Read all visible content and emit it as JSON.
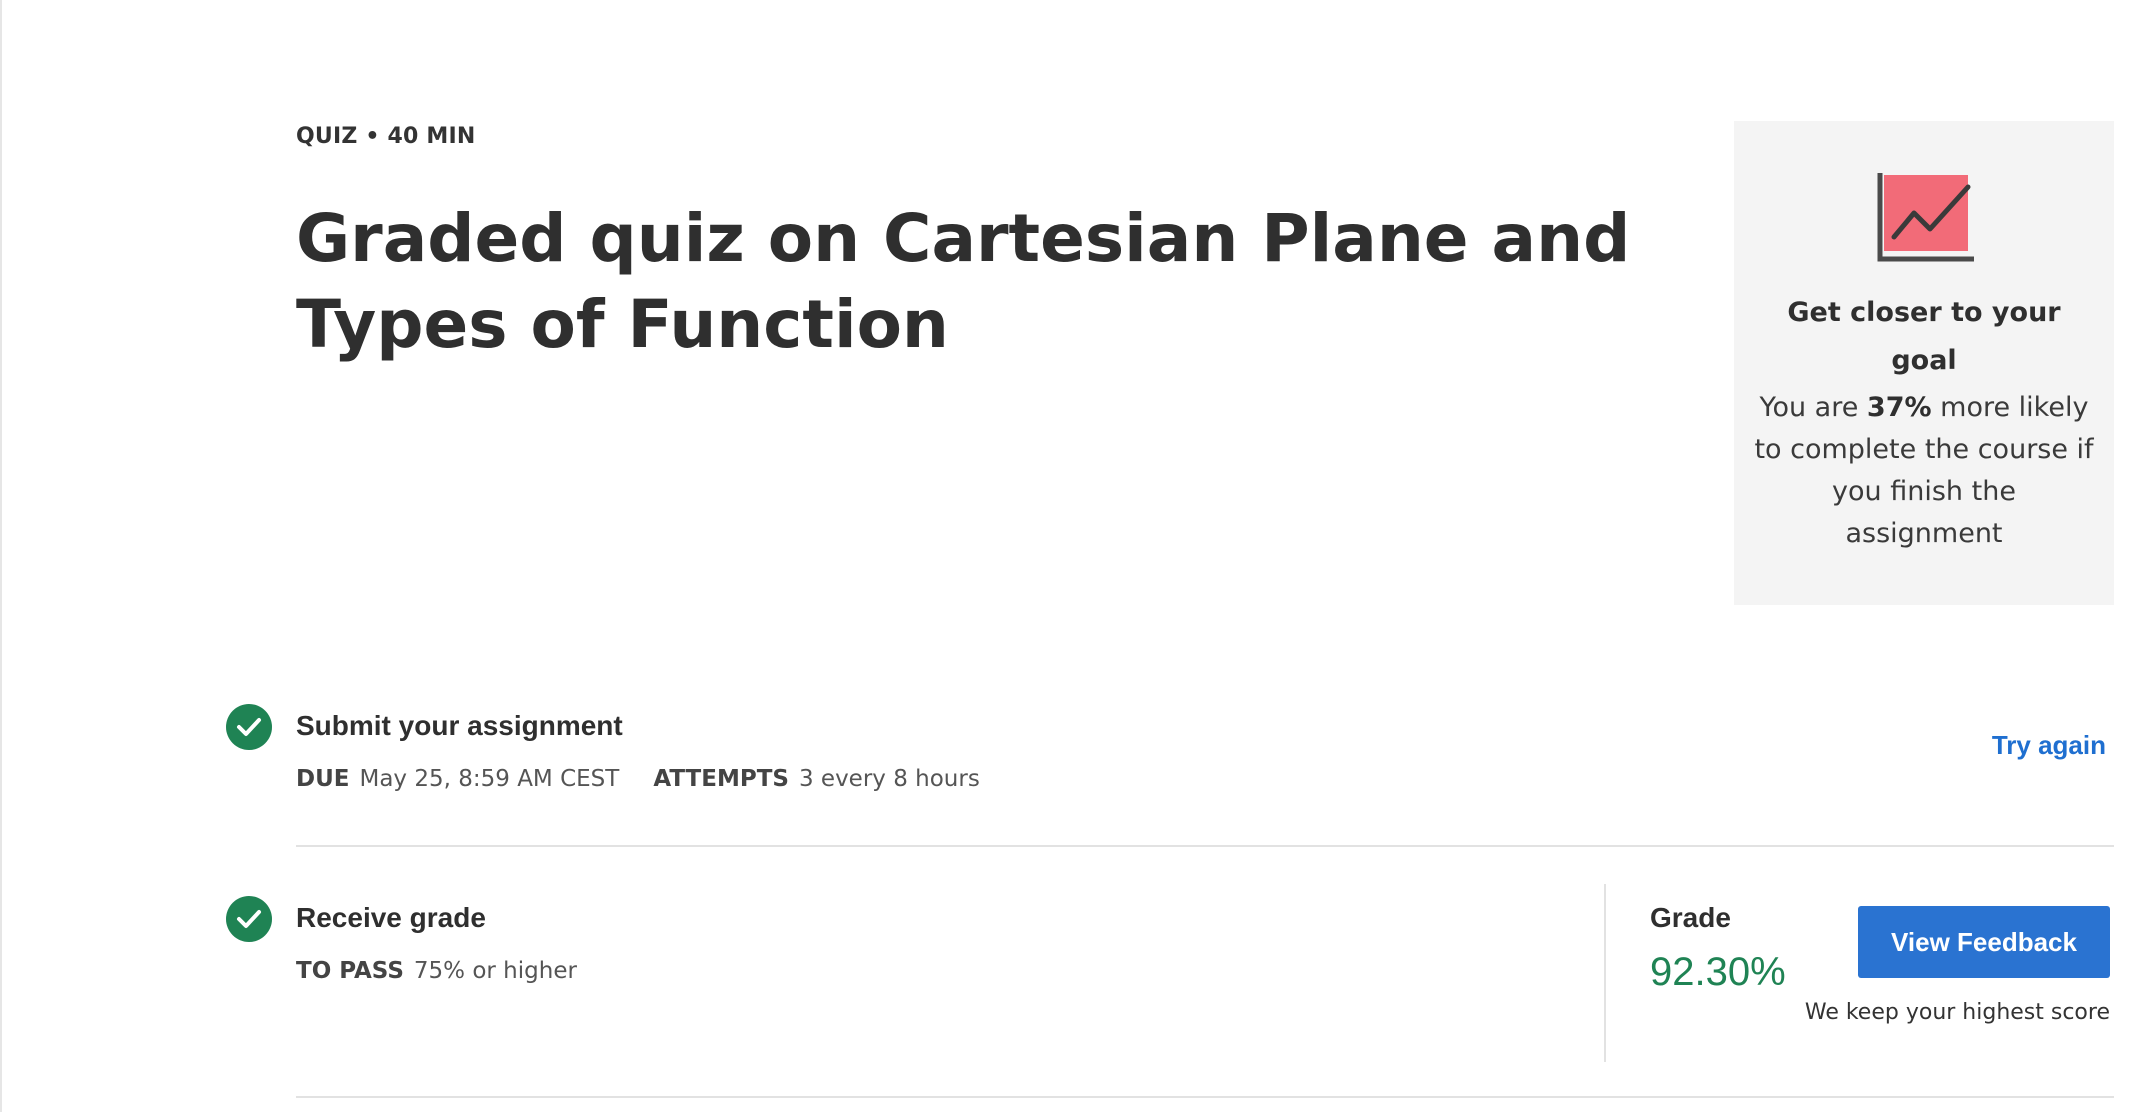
{
  "header": {
    "meta": "QUIZ • 40 MIN",
    "title": "Graded quiz on Cartesian Plane and Types of Function"
  },
  "goal_card": {
    "icon": "trend-chart-icon",
    "heading": "Get closer to your goal",
    "text_prefix": "You are ",
    "percent": "37%",
    "text_suffix": " more likely to complete the course if you finish the assignment"
  },
  "submit": {
    "title": "Submit your assignment",
    "due_label": "DUE",
    "due_value": "May 25, 8:59 AM CEST",
    "attempts_label": "ATTEMPTS",
    "attempts_value": "3 every 8 hours",
    "try_again": "Try again",
    "status_icon": "checkmark-circle-icon"
  },
  "receive": {
    "title": "Receive grade",
    "pass_label": "TO PASS",
    "pass_value": "75% or higher",
    "status_icon": "checkmark-circle-icon"
  },
  "grade": {
    "label": "Grade",
    "value": "92.30%",
    "button": "View Feedback",
    "note": "We keep your highest score"
  },
  "colors": {
    "success": "#1f8354",
    "link": "#1f6fd0",
    "button": "#2a73d1",
    "card_bg": "#f4f4f4",
    "icon_fill": "#f26b78"
  }
}
